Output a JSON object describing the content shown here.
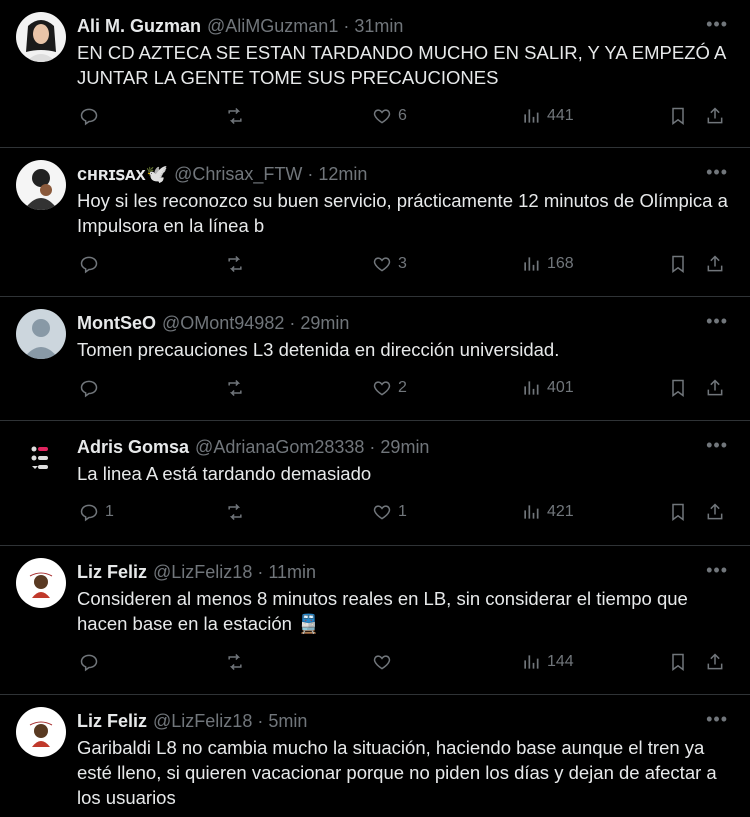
{
  "tweets": [
    {
      "name": "Ali M. Guzman",
      "handle": "@AliMGuzman1",
      "dot": "·",
      "time": "31min",
      "text": "EN CD AZTECA SE ESTAN TARDANDO MUCHO EN SALIR, Y YA EMPEZÓ A JUNTAR LA GENTE TOME SUS PRECAUCIONES",
      "replies": "",
      "retweets": "",
      "likes": "6",
      "views": "441"
    },
    {
      "name": "ᴄʜʀɪꜱᴀx🕊️",
      "handle": "@Chrisax_FTW",
      "dot": "·",
      "time": "12min",
      "text": "Hoy si les reconozco su buen servicio, prácticamente 12 minutos de Olímpica a Impulsora en la línea b",
      "replies": "",
      "retweets": "",
      "likes": "3",
      "views": "168"
    },
    {
      "name": "MontSeO",
      "handle": "@OMont94982",
      "dot": "·",
      "time": "29min",
      "text": "Tomen precauciones L3 detenida en dirección universidad.",
      "replies": "",
      "retweets": "",
      "likes": "2",
      "views": "401"
    },
    {
      "name": "Adris Gomsa",
      "handle": "@AdrianaGom28338",
      "dot": "·",
      "time": "29min",
      "text": "La linea A está tardando demasiado",
      "replies": "1",
      "retweets": "",
      "likes": "1",
      "views": "421"
    },
    {
      "name": "Liz Feliz",
      "handle": "@LizFeliz18",
      "dot": "·",
      "time": "11min",
      "text": "Consideren al menos 8 minutos reales en LB, sin considerar el tiempo que hacen base en la estación 🚆",
      "replies": "",
      "retweets": "",
      "likes": "",
      "views": "144"
    },
    {
      "name": "Liz Feliz",
      "handle": "@LizFeliz18",
      "dot": "·",
      "time": "5min",
      "text": "Garibaldi L8 no cambia mucho la situación, haciendo base aunque el tren ya esté lleno, si quieren vacacionar porque no piden los días y dejan de afectar a los usuarios",
      "replies": "",
      "retweets": "",
      "likes": "",
      "views": ""
    }
  ],
  "icons": {
    "more": "more-icon",
    "reply": "reply-icon",
    "retweet": "retweet-icon",
    "like": "like-icon",
    "views": "views-icon",
    "bookmark": "bookmark-icon",
    "share": "share-icon"
  },
  "colors": {
    "background": "#000000",
    "text": "#e7e9ea",
    "muted": "#71767b",
    "divider": "#2f3336"
  }
}
